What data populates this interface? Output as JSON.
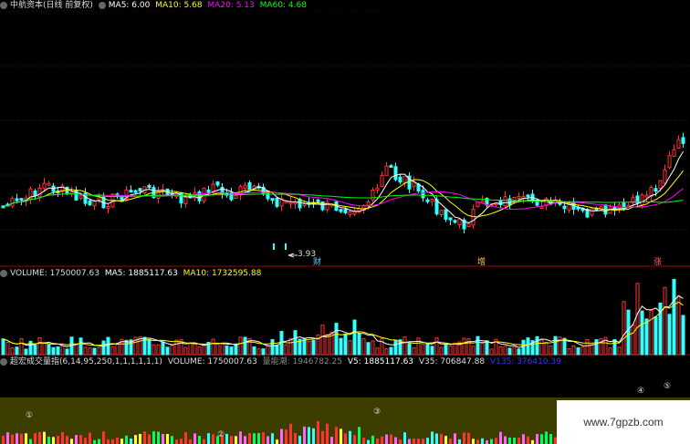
{
  "main_legend": {
    "title": "中航资本(日线 前复权)",
    "ma5": "MA5: 6.00",
    "ma10": "MA10: 5.68",
    "ma20": "MA20: 5.13",
    "ma60": "MA60: 4.68",
    "colors": {
      "ma5": "#ffffff",
      "ma10": "#ffff00",
      "ma20": "#ff00ff",
      "ma60": "#00ff00"
    }
  },
  "price_annotations": {
    "low_price": "3.93",
    "marker_cai": "财",
    "marker_zeng": "增",
    "marker_zhang": "涨"
  },
  "volume_legend": {
    "title": "VOLUME: 1750007.63",
    "ma5": "MA5: 1885117.63",
    "ma10": "MA10: 1732595.88"
  },
  "indicator_legend": {
    "title": "超宏成交量指(6,14,95,250,1,1,1,1,1,1)",
    "volume": "VOLUME: 1750007.63",
    "liang_neng_chao": "量能潮: 1946782.25",
    "v5": "V5: 1885117.63",
    "v35": "V35: 706847.88",
    "v135": "V135: 376410.39"
  },
  "indicator_markers": [
    "①",
    "②",
    "③",
    "④",
    "⑤"
  ],
  "watermark": "www.7gpzb.com"
}
